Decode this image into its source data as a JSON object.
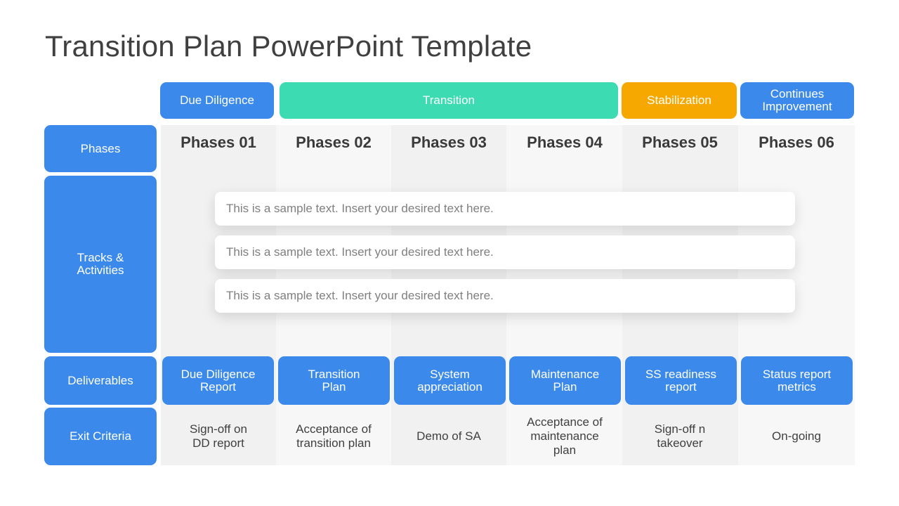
{
  "slide": {
    "title": "Transition Plan PowerPoint Template"
  },
  "colors": {
    "blue": "#3b89ea",
    "teal": "#3ddbb2",
    "amber": "#f7a800",
    "text_dark": "#404040",
    "text_muted": "#7f7f7f",
    "stripe_dark": "#f1f1f1",
    "stripe_light": "#f7f7f7"
  },
  "categories": [
    {
      "label": "Due Diligence",
      "color": "#3b89ea"
    },
    {
      "label": "Transition",
      "color": "#3ddbb2"
    },
    {
      "label": "Stabilization",
      "color": "#f7a800"
    },
    {
      "label": "Continues Improvement",
      "color": "#3b89ea"
    }
  ],
  "row_labels": {
    "phases": "Phases",
    "tracks": "Tracks & Activities",
    "deliverables": "Deliverables",
    "exit_criteria": "Exit Criteria"
  },
  "phases": [
    "Phases 01",
    "Phases 02",
    "Phases 03",
    "Phases 04",
    "Phases 05",
    "Phases 06"
  ],
  "tracks": [
    "This is a sample text. Insert your desired text here.",
    "This is a sample text. Insert your desired text here.",
    "This is a sample text. Insert your desired text here."
  ],
  "deliverables": [
    "Due Diligence Report",
    "Transition Plan",
    "System appreciation",
    "Maintenance Plan",
    "SS readiness report",
    "Status report metrics"
  ],
  "exit_criteria": [
    "Sign-off on\nDD report",
    "Acceptance of\ntransition plan",
    "Demo of SA",
    "Acceptance of\nmaintenance\nplan",
    "Sign-off n\ntakeover",
    "On-going"
  ]
}
